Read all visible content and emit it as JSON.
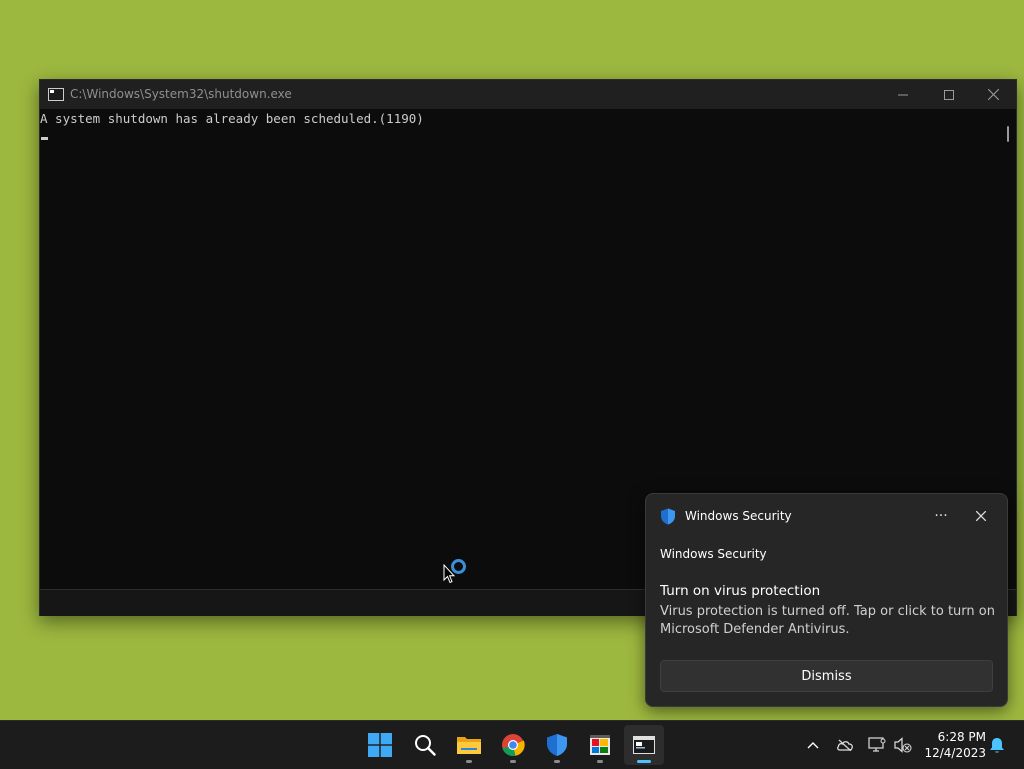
{
  "console": {
    "title": "C:\\Windows\\System32\\shutdown.exe",
    "output_line": "A system shutdown has already been scheduled.(1190)"
  },
  "toast": {
    "app_name": "Windows Security",
    "header": "Windows Security",
    "title": "Turn on virus protection",
    "body": "Virus protection is turned off. Tap or click to turn on Microsoft Defender Antivirus.",
    "more_glyph": "···",
    "dismiss_label": "Dismiss"
  },
  "taskbar": {
    "apps": [
      {
        "name": "start",
        "icon": "windows-logo-icon"
      },
      {
        "name": "search",
        "icon": "search-icon"
      },
      {
        "name": "file-explorer",
        "icon": "folder-icon"
      },
      {
        "name": "chrome",
        "icon": "chrome-icon"
      },
      {
        "name": "windows-security",
        "icon": "shield-icon"
      },
      {
        "name": "paint",
        "icon": "paint-icon"
      },
      {
        "name": "console",
        "icon": "console-icon",
        "active": true
      }
    ],
    "tray_icons": [
      "chevron-up-icon",
      "cloud-offline-icon",
      "network-icon",
      "volume-muted-icon",
      "bell-icon"
    ],
    "time": "6:28 PM",
    "date": "12/4/2023"
  },
  "colors": {
    "desktop": "#9db83f",
    "accent": "#4cc2ff",
    "console_bg": "#0c0c0c",
    "toast_bg": "#262626"
  }
}
